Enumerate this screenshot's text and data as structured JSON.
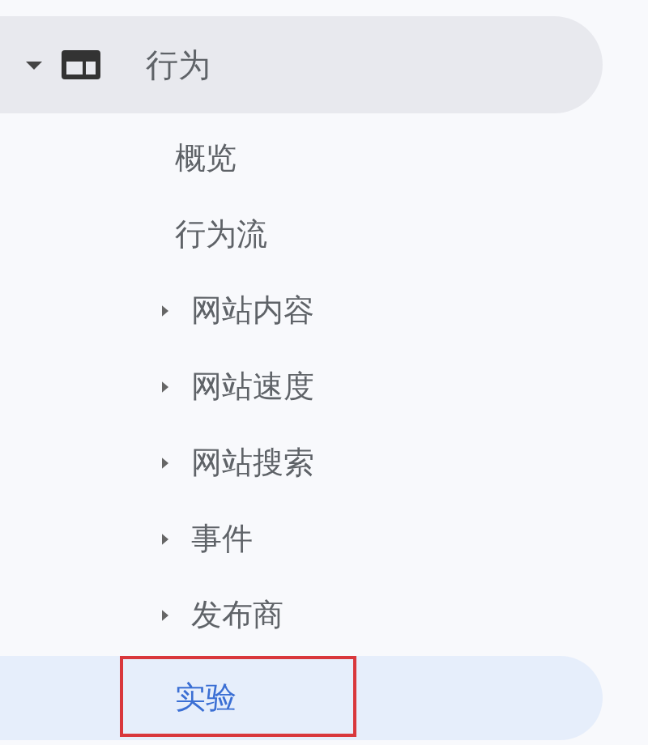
{
  "section": {
    "label": "行为",
    "expanded": true
  },
  "items": [
    {
      "label": "概览",
      "kind": "leaf",
      "selected": false,
      "highlighted": false
    },
    {
      "label": "行为流",
      "kind": "leaf",
      "selected": false,
      "highlighted": false
    },
    {
      "label": "网站内容",
      "kind": "group",
      "expanded": false,
      "selected": false,
      "highlighted": false
    },
    {
      "label": "网站速度",
      "kind": "group",
      "expanded": false,
      "selected": false,
      "highlighted": false
    },
    {
      "label": "网站搜索",
      "kind": "group",
      "expanded": false,
      "selected": false,
      "highlighted": false
    },
    {
      "label": "事件",
      "kind": "group",
      "expanded": false,
      "selected": false,
      "highlighted": false
    },
    {
      "label": "发布商",
      "kind": "group",
      "expanded": false,
      "selected": false,
      "highlighted": false
    },
    {
      "label": "实验",
      "kind": "leaf",
      "selected": true,
      "highlighted": true
    }
  ]
}
